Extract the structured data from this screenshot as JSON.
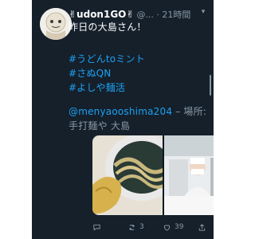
{
  "tweet": {
    "display_name": "✌udon1GO✌",
    "handle_time": "@... · 21時間",
    "lines": {
      "l1": "昨日の大島さん！",
      "tag1": "#うどんtoミント",
      "tag2": "#さぬQN",
      "tag3": "#よしや麺活",
      "mention": "@menyaooshima204",
      "location_sep": " – 場所:",
      "place": "手打麺や 大島"
    }
  },
  "actions": {
    "reply_count": "",
    "retweet_count": "3",
    "like_count": "39"
  },
  "colors": {
    "background": "#15202b",
    "text": "#ffffff",
    "link": "#1da1f2",
    "muted": "#8899a6"
  },
  "icons": {
    "reply": "reply-icon",
    "retweet": "retweet-icon",
    "like": "heart-icon",
    "share": "share-icon",
    "more": "chevron-down-icon"
  }
}
